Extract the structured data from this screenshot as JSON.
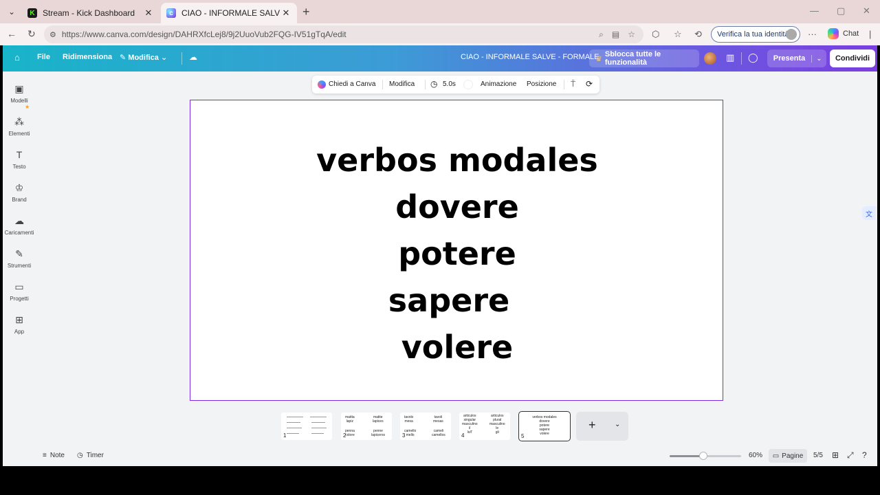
{
  "browser": {
    "tabs": [
      {
        "title": "Stream - Kick Dashboard",
        "active": false
      },
      {
        "title": "CIAO - INFORMALE SALVE - FORM",
        "active": true
      }
    ],
    "url": "https://www.canva.com/design/DAHRXfcLej8/9j2UuoVub2FQG-IV51gTqA/edit",
    "verify_label": "Verifica la tua identità",
    "chat_label": "Chat"
  },
  "canva": {
    "menu": {
      "file": "File",
      "resize": "Ridimensiona",
      "edit": "Modifica"
    },
    "design_title": "CIAO - INFORMALE SALVE - FORMALE",
    "unlock_label": "Sblocca tutte le funzionalità",
    "present_label": "Presenta",
    "share_label": "Condividi",
    "sidebar": [
      {
        "label": "Modelli",
        "icon": "templates-icon"
      },
      {
        "label": "Elementi",
        "icon": "elements-icon"
      },
      {
        "label": "Testo",
        "icon": "text-icon"
      },
      {
        "label": "Brand",
        "icon": "brand-icon"
      },
      {
        "label": "Caricamenti",
        "icon": "uploads-icon"
      },
      {
        "label": "Strumenti",
        "icon": "tools-icon"
      },
      {
        "label": "Progetti",
        "icon": "projects-icon"
      },
      {
        "label": "App",
        "icon": "apps-icon"
      }
    ],
    "context_bar": {
      "ask": "Chiedi a Canva",
      "edit": "Modifica",
      "duration": "5.0s",
      "animation": "Animazione",
      "position": "Posizione"
    },
    "slide_lines": [
      "verbos modales",
      "dovere",
      "potere",
      "sapere",
      "volere"
    ],
    "thumbnails": [
      {
        "number": "1"
      },
      {
        "number": "2",
        "top_left": [
          "matita",
          "lapiz"
        ],
        "top_right": [
          "matite",
          "lapices"
        ],
        "bottom_left": [
          "penna",
          "colore"
        ],
        "bottom_right": [
          "penne",
          "lapiceros"
        ]
      },
      {
        "number": "3",
        "top_left": [
          "tavolo",
          "mesa"
        ],
        "top_right": [
          "tavoli",
          "mesas"
        ],
        "bottom_left": [
          "camello",
          "mello"
        ],
        "bottom_right": [
          "cameli",
          "camellos"
        ]
      },
      {
        "number": "4",
        "top_left": [
          "articulos",
          "singular",
          "masculino",
          "il",
          "lo/l'"
        ],
        "top_right": [
          "articulos",
          "plural",
          "masculino",
          "le",
          "gli"
        ]
      },
      {
        "number": "5",
        "lines": [
          "verbos modales",
          "dovere",
          "potere",
          "sapere",
          "volere"
        ]
      }
    ],
    "bottom": {
      "notes": "Note",
      "timer": "Timer",
      "zoom": "60%",
      "zoom_fraction": 0.47,
      "pages_label": "Pagine",
      "page_counter": "5/5"
    }
  }
}
